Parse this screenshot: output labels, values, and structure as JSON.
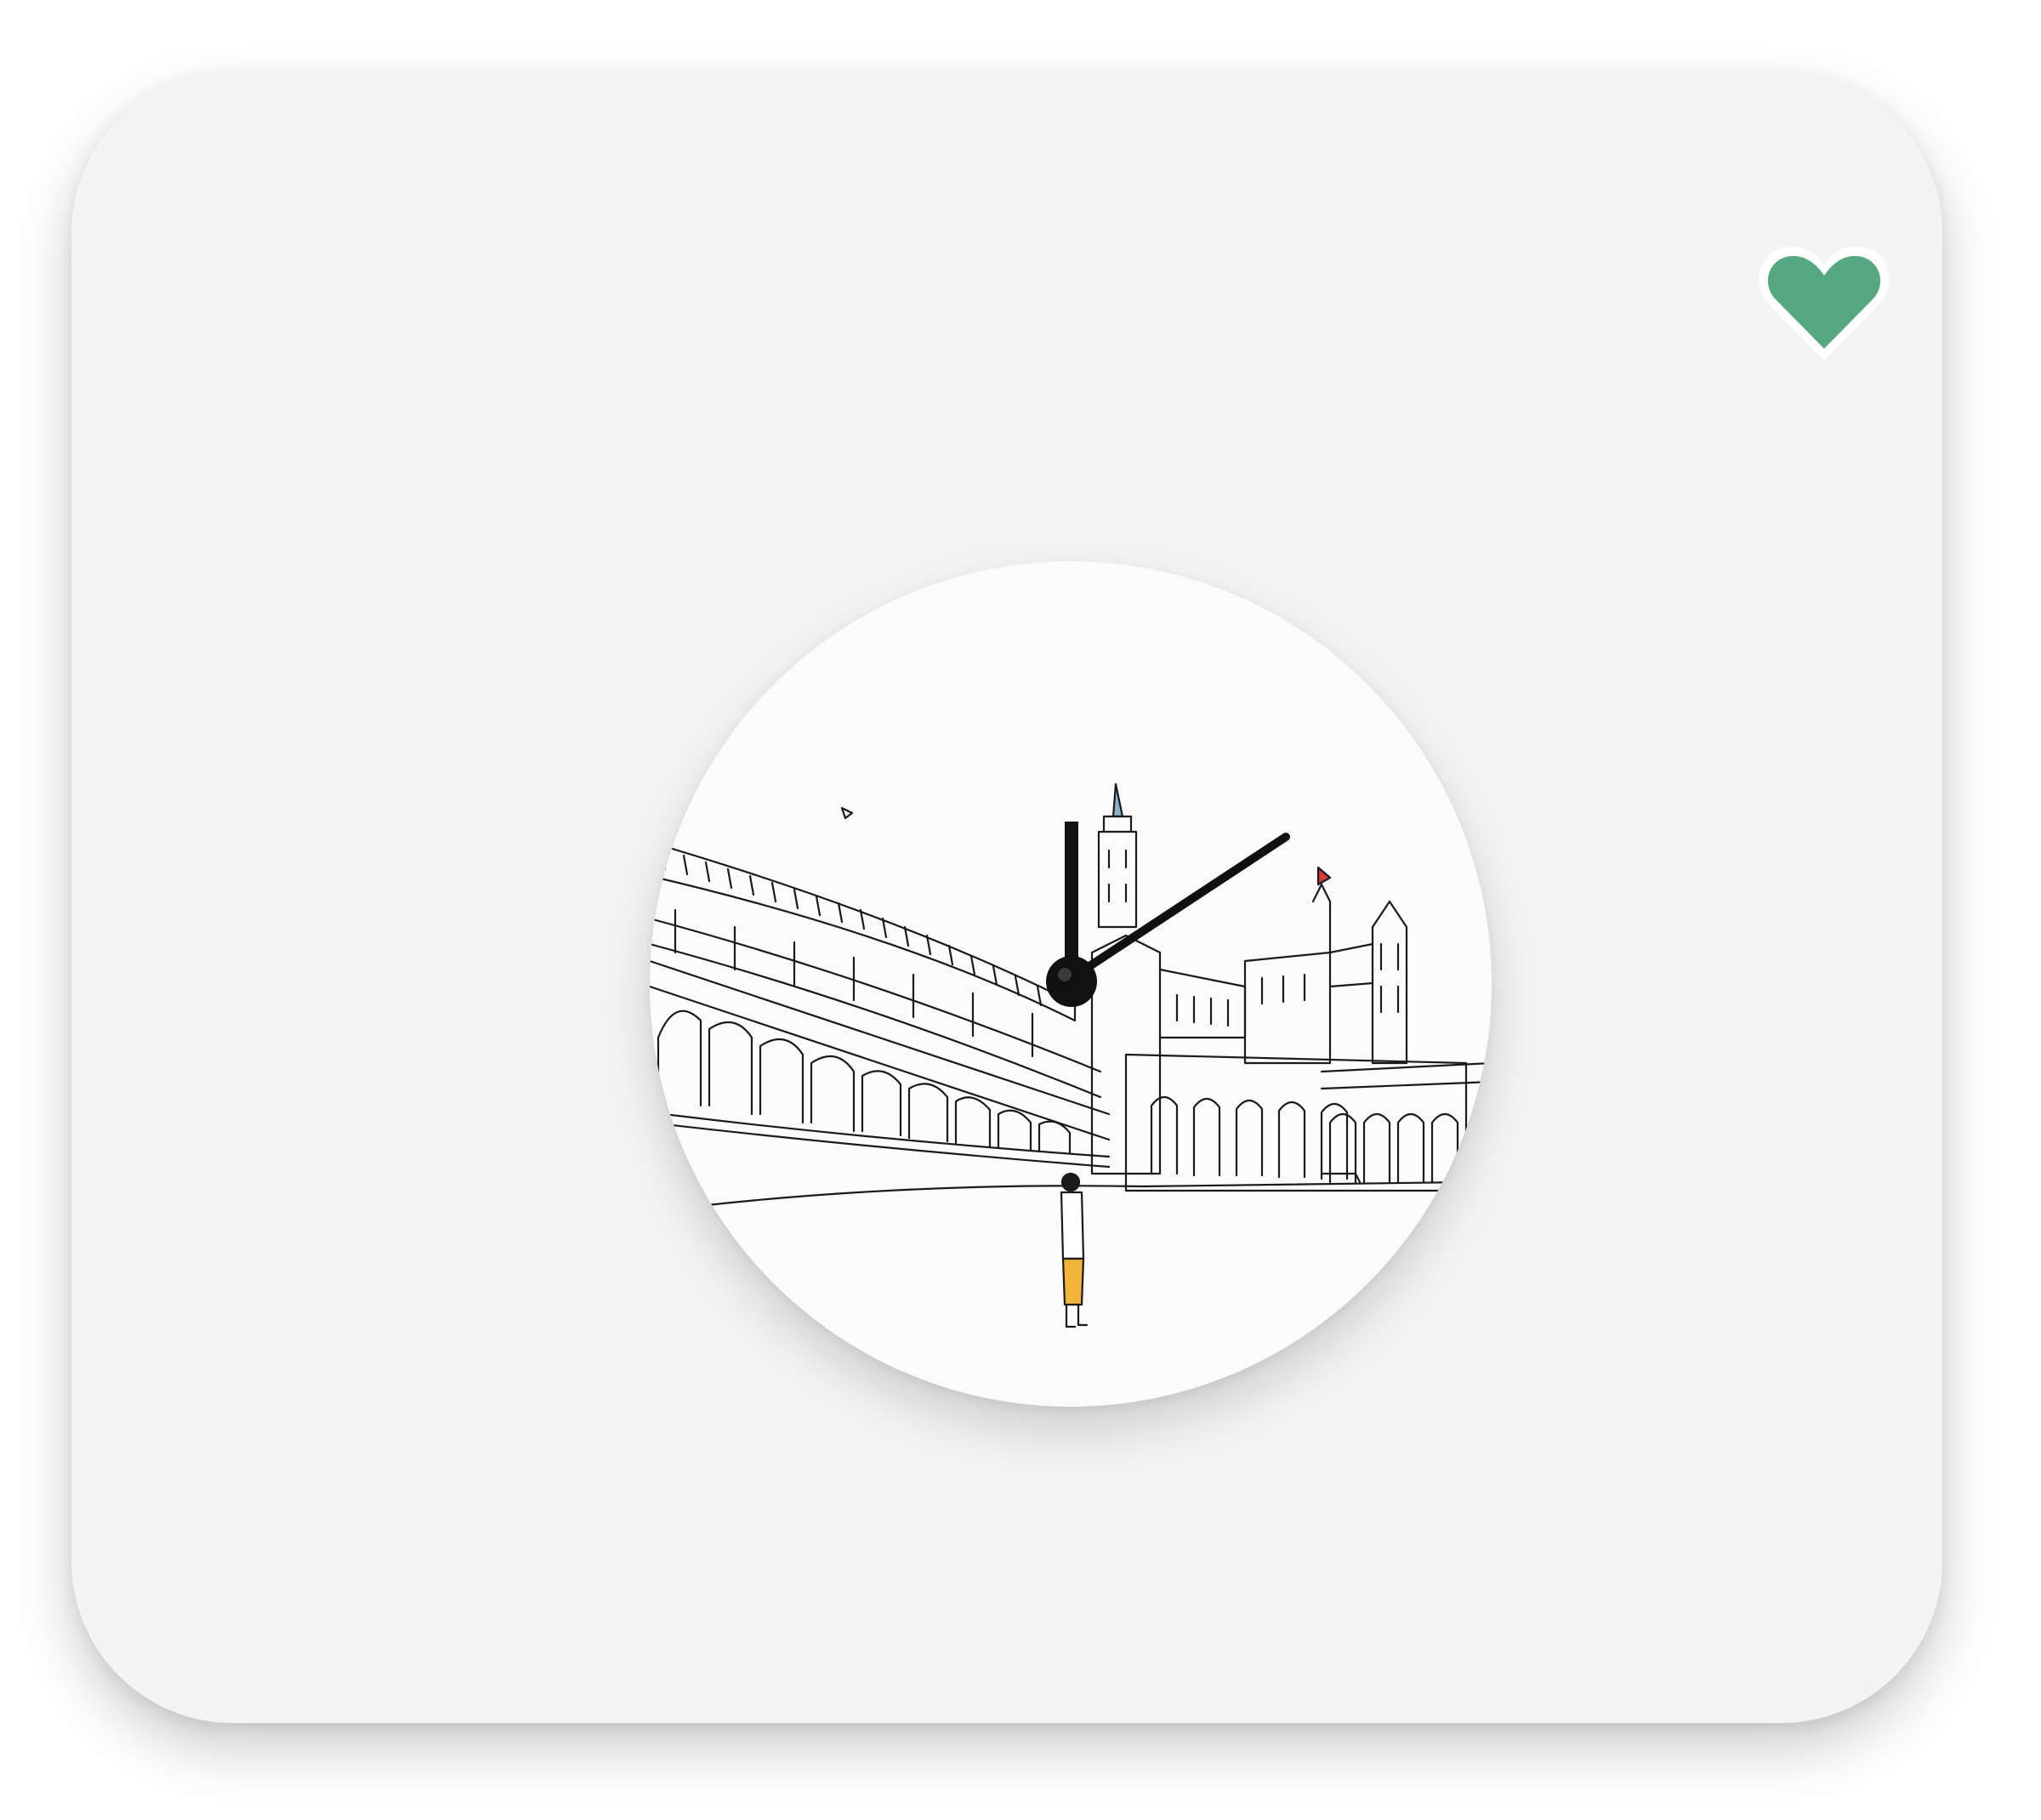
{
  "card": {
    "favorite": {
      "icon": "heart-icon",
      "state": "favorited",
      "color": "#55a882",
      "outline_color": "#ffffff"
    },
    "product": {
      "image": "wall-clock-line-drawing",
      "face_color": "#fbfbfc",
      "hands_color": "#111111",
      "accent_colors": [
        "#8ab0c9",
        "#d43a3a",
        "#f2b53c"
      ]
    }
  }
}
